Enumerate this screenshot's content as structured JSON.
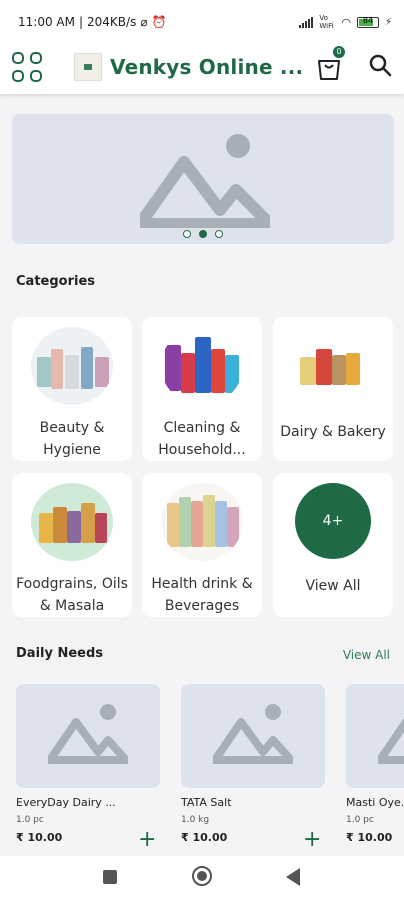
{
  "status_bar": {
    "time": "11:00 AM",
    "speed": "204KB/s",
    "network": "Vo WiFi",
    "battery": "84"
  },
  "app_bar": {
    "title": "Venkys Online ...",
    "cart_count": "0",
    "icons": [
      "grid-menu-icon",
      "cart-icon",
      "search-icon"
    ],
    "accent": "#1e6a44"
  },
  "banner": {
    "pages": 3,
    "active_page": 2
  },
  "categories": {
    "title": "Categories",
    "items": [
      {
        "label": "Beauty & Hygiene"
      },
      {
        "label": "Cleaning & Household..."
      },
      {
        "label": "Dairy & Bakery"
      },
      {
        "label": "Foodgrains, Oils & Masala"
      },
      {
        "label": "Health drink & Beverages"
      },
      {
        "label": "View All",
        "badge": "4+"
      }
    ]
  },
  "daily_needs": {
    "title": "Daily Needs",
    "view_all": "View All",
    "products": [
      {
        "name": "EveryDay Dairy ...",
        "qty": "1.0 pc",
        "price": "₹ 10.00",
        "add": "+"
      },
      {
        "name": "TATA Salt",
        "qty": "1.0 kg",
        "price": "₹ 10.00",
        "add": "+"
      },
      {
        "name": "Masti Oye...",
        "qty": "1.0 pc",
        "price": "₹ 10.00",
        "add": "+"
      }
    ]
  }
}
